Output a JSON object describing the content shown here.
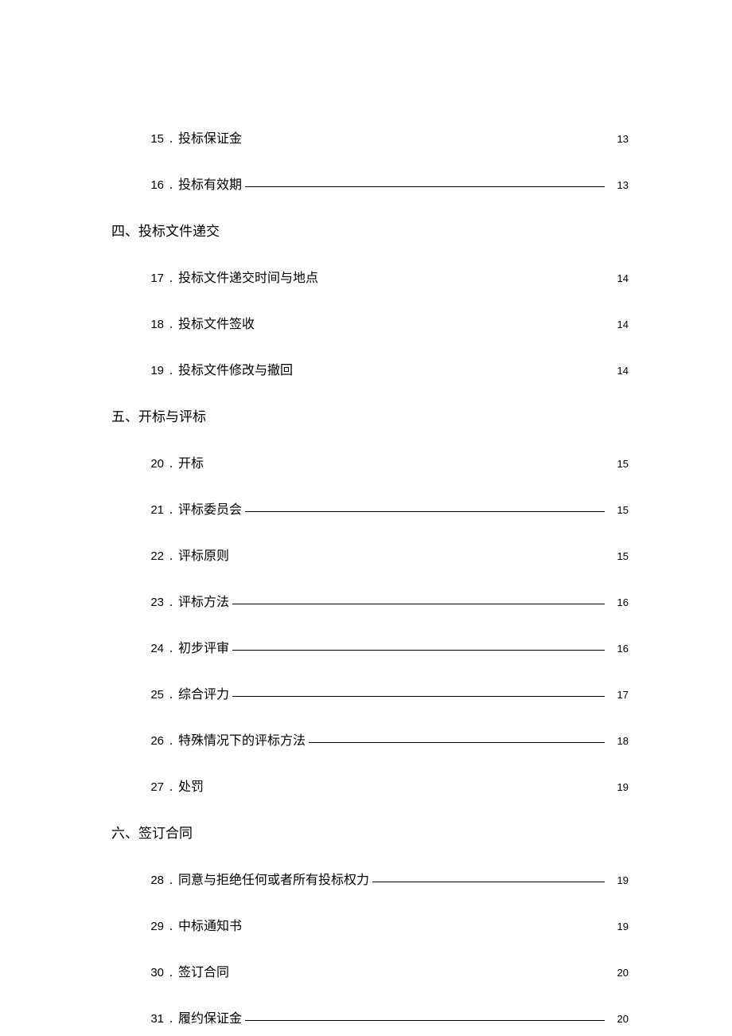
{
  "entries": [
    {
      "type": "item",
      "num": "15",
      "title": "投标保证金",
      "page": "13",
      "underline": false
    },
    {
      "type": "item",
      "num": "16",
      "title": "投标有效期",
      "page": "13",
      "underline": true
    },
    {
      "type": "heading",
      "text": "四、投标文件递交"
    },
    {
      "type": "item",
      "num": "17",
      "title": "投标文件递交时间与地点",
      "page": "14",
      "underline": false
    },
    {
      "type": "item",
      "num": "18",
      "title": "投标文件签收",
      "page": "14",
      "underline": false
    },
    {
      "type": "item",
      "num": "19",
      "title": "投标文件修改与撤回",
      "page": "14",
      "underline": false
    },
    {
      "type": "heading",
      "text": "五、开标与评标"
    },
    {
      "type": "item",
      "num": "20",
      "title": "开标",
      "page": "15",
      "underline": false
    },
    {
      "type": "item",
      "num": "21",
      "title": "评标委员会",
      "page": "15",
      "underline": true
    },
    {
      "type": "item",
      "num": "22",
      "title": "评标原则",
      "page": "15",
      "underline": false
    },
    {
      "type": "item",
      "num": "23",
      "title": "评标方法",
      "page": "16",
      "underline": true
    },
    {
      "type": "item",
      "num": "24",
      "title": "初步评审",
      "page": "16",
      "underline": true
    },
    {
      "type": "item",
      "num": "25",
      "title": "综合评力",
      "page": "17",
      "underline": true
    },
    {
      "type": "item",
      "num": "26",
      "title": "特殊情况下的评标方法",
      "page": "18",
      "underline": true
    },
    {
      "type": "item",
      "num": "27",
      "title": "处罚",
      "page": "19",
      "underline": false
    },
    {
      "type": "heading",
      "text": "六、签订合同"
    },
    {
      "type": "item",
      "num": "28",
      "title": "同意与拒绝任何或者所有投标权力",
      "page": "19",
      "underline": true
    },
    {
      "type": "item",
      "num": "29",
      "title": "中标通知书",
      "page": "19",
      "underline": false
    },
    {
      "type": "item",
      "num": "30",
      "title": "签订合同",
      "page": "20",
      "underline": false
    },
    {
      "type": "item",
      "num": "31",
      "title": "履约保证金",
      "page": "20",
      "underline": true
    }
  ]
}
